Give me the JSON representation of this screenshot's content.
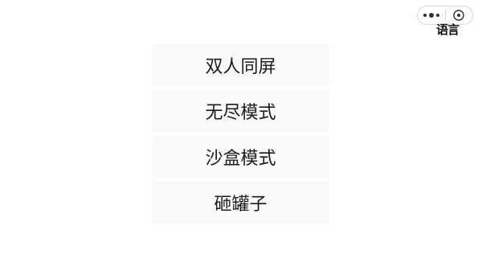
{
  "top_bar": {
    "more_icon": "more-dots-icon",
    "close_icon": "close-icon",
    "language_label": "语言"
  },
  "menu": {
    "items": [
      {
        "label": "双人同屏"
      },
      {
        "label": "无尽模式"
      },
      {
        "label": "沙盒模式"
      },
      {
        "label": "砸罐子"
      }
    ]
  },
  "colors": {
    "background": "#ffffff",
    "menu_item_bg": "#f9f9f9",
    "text": "#1c1c1c"
  }
}
